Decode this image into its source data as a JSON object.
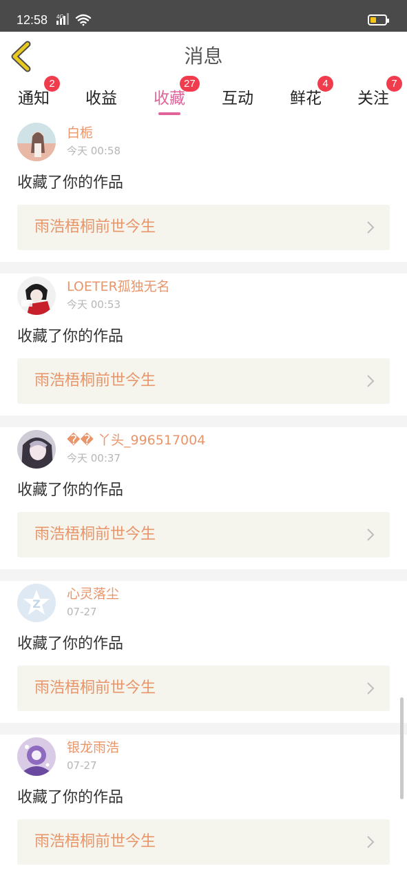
{
  "status_bar": {
    "time": "12:58",
    "network": "4G",
    "icons": [
      "signal-icon",
      "wifi-icon",
      "battery-icon"
    ]
  },
  "header": {
    "title": "消息",
    "back_icon": "chevron-left-icon"
  },
  "tabs": [
    {
      "label": "通知",
      "badge": "2",
      "active": false
    },
    {
      "label": "收益",
      "badge": "",
      "active": false
    },
    {
      "label": "收藏",
      "badge": "27",
      "active": true
    },
    {
      "label": "互动",
      "badge": "",
      "active": false
    },
    {
      "label": "鲜花",
      "badge": "4",
      "active": false
    },
    {
      "label": "关注",
      "badge": "7",
      "active": false
    }
  ],
  "feed": [
    {
      "username": "白栀",
      "time": "今天 00:58",
      "action": "收藏了你的作品",
      "work": "雨浩梧桐前世今生"
    },
    {
      "username": "LOETER孤独无名",
      "time": "今天 00:53",
      "action": "收藏了你的作品",
      "work": "雨浩梧桐前世今生"
    },
    {
      "username": "�� 丫头_996517004",
      "time": "今天 00:37",
      "action": "收藏了你的作品",
      "work": "雨浩梧桐前世今生"
    },
    {
      "username": "心灵落尘",
      "time": "07-27",
      "action": "收藏了你的作品",
      "work": "雨浩梧桐前世今生"
    },
    {
      "username": "银龙雨浩",
      "time": "07-27",
      "action": "收藏了你的作品",
      "work": "雨浩梧桐前世今生"
    }
  ],
  "colors": {
    "accent": "#e0649a",
    "name_orange": "#e8956a",
    "badge_red": "#f03c4d",
    "card_bg": "#f5f5ed",
    "back_arrow": "#c8a400"
  }
}
